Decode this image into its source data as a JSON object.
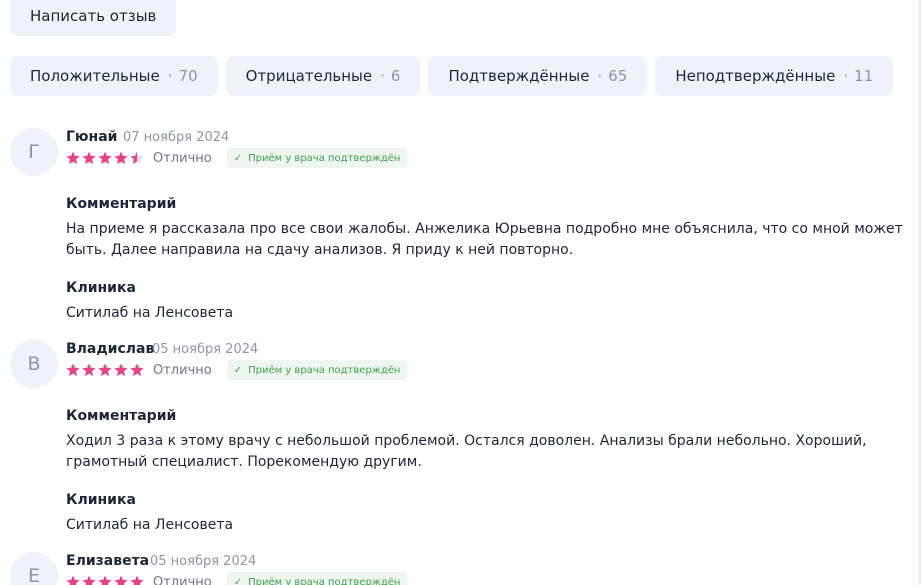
{
  "write_review_label": "Написать отзыв",
  "filters": [
    {
      "label": "Положительные",
      "count": "70"
    },
    {
      "label": "Отрицательные",
      "count": "6"
    },
    {
      "label": "Подтверждённые",
      "count": "65"
    },
    {
      "label": "Неподтверждённые",
      "count": "11"
    }
  ],
  "dot": "·",
  "reviews": [
    {
      "initial": "Г",
      "name": "Гюнай",
      "date": "07 ноября 2024",
      "rating": 4.5,
      "rating_label": "Отлично",
      "badge_check": "✓",
      "badge": "Приём у врача подтверждён",
      "comment_title": "Комментарий",
      "comment": "На приеме я рассказала про все свои жалобы. Анжелика Юрьевна подробно мне объяснила, что со мной может быть. Далее направила на сдачу анализов. Я приду к ней повторно.",
      "clinic_title": "Клиника",
      "clinic": "Ситилаб на Ленсовета"
    },
    {
      "initial": "В",
      "name": "Владислав",
      "date": "05 ноября 2024",
      "rating": 5,
      "rating_label": "Отлично",
      "badge_check": "✓",
      "badge": "Приём у врача подтверждён",
      "comment_title": "Комментарий",
      "comment": "Ходил 3 раза к этому врачу с небольшой проблемой. Остался доволен. Анализы брали небольно. Хороший, грамотный специалист. Порекомендую другим.",
      "clinic_title": "Клиника",
      "clinic": "Ситилаб на Ленсовета"
    },
    {
      "initial": "Е",
      "name": "Елизавета",
      "date": "05 ноября 2024",
      "rating": 5,
      "rating_label": "Отлично",
      "badge_check": "✓",
      "badge": "Приём у врача подтверждён"
    }
  ],
  "colors": {
    "star": "#e8408a",
    "star_empty": "#d9dee6",
    "badge_text": "#3ea24f",
    "chip_bg": "#eef3fb"
  }
}
